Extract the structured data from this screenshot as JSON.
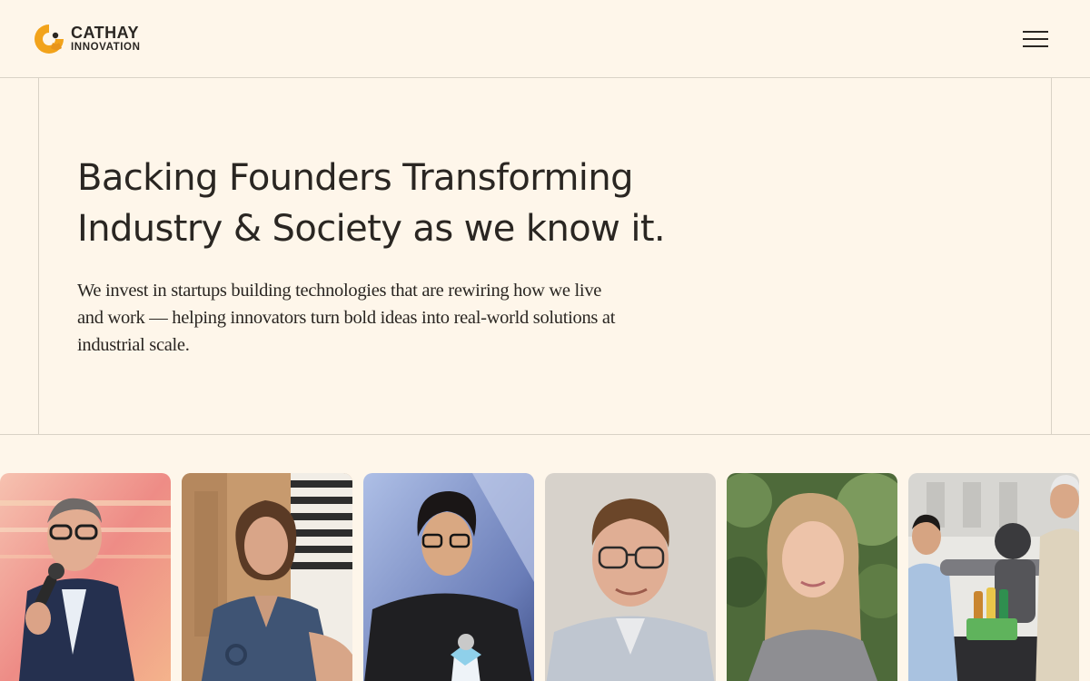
{
  "header": {
    "logo": {
      "line1": "CATHAY",
      "line2": "INNOVATION",
      "icon": "cathay-c-mark-icon",
      "brand_color": "#f2a31b"
    },
    "menu_button": {
      "icon": "hamburger-menu-icon"
    }
  },
  "hero": {
    "headline_line1": "Backing Founders Transforming",
    "headline_line2": "Industry & Society as we know it.",
    "intro": "We invest in startups building technologies that are rewiring how we live and work — helping innovators turn bold ideas into real-world solutions at industrial scale."
  },
  "portraits": [
    {
      "subject": "speaker with microphone on stage"
    },
    {
      "subject": "woman in denim shirt"
    },
    {
      "subject": "young man holding microphone"
    },
    {
      "subject": "man with glasses, studio portrait"
    },
    {
      "subject": "woman with long blonde hair outdoors"
    },
    {
      "subject": "team with robot arm in lab"
    }
  ],
  "colors": {
    "background": "#fef6ea",
    "text": "#2a2622",
    "divider": "#d9d2c6",
    "accent": "#f2a31b"
  }
}
